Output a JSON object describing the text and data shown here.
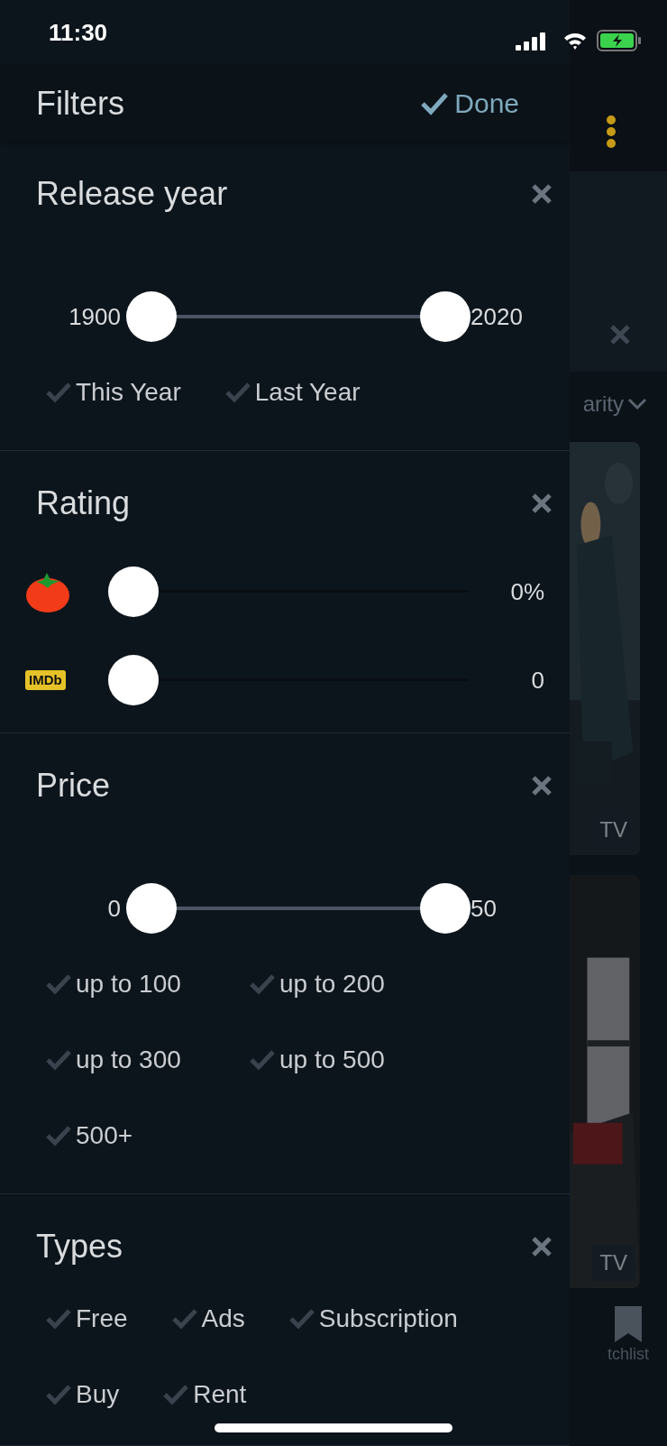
{
  "status_bar": {
    "time": "11:30"
  },
  "header": {
    "title": "Filters",
    "done": "Done"
  },
  "sections": [
    {
      "kind": "range",
      "title": "Release year",
      "min_label": "1900",
      "max_label": "2020",
      "thumbs": [
        {
          "level": 0
        },
        {
          "level": 1
        }
      ],
      "chips": [
        {
          "label": "This Year",
          "checked": false
        },
        {
          "label": "Last Year",
          "checked": false
        }
      ]
    },
    {
      "kind": "rating",
      "title": "Rating",
      "rows": [
        {
          "kind": "tomato",
          "level": 0,
          "reading": "0%"
        },
        {
          "kind": "imdb",
          "logo": "IMDb",
          "level": 0,
          "reading": "0"
        }
      ]
    },
    {
      "kind": "range",
      "title": "Price",
      "min_label": "0",
      "max_label": "50",
      "thumbs": [
        {
          "level": 0
        },
        {
          "level": 1
        }
      ],
      "chips": [
        {
          "label": "up to 100",
          "checked": false
        },
        {
          "label": "up to 200",
          "checked": false
        },
        {
          "label": "up to 300",
          "checked": false
        },
        {
          "label": "up to 500",
          "checked": false
        },
        {
          "label": "500+",
          "checked": false
        }
      ]
    },
    {
      "kind": "chips",
      "title": "Types",
      "chips": [
        {
          "label": "Free",
          "checked": false
        },
        {
          "label": "Ads",
          "checked": false
        },
        {
          "label": "Subscription",
          "checked": false
        },
        {
          "label": "Buy",
          "checked": false
        },
        {
          "label": "Rent",
          "checked": false
        }
      ]
    }
  ],
  "background": {
    "sort_label": "arity",
    "posters": [
      {
        "badge": "TV"
      },
      {
        "badge": "TV"
      }
    ],
    "nav_label": "tchlist"
  }
}
